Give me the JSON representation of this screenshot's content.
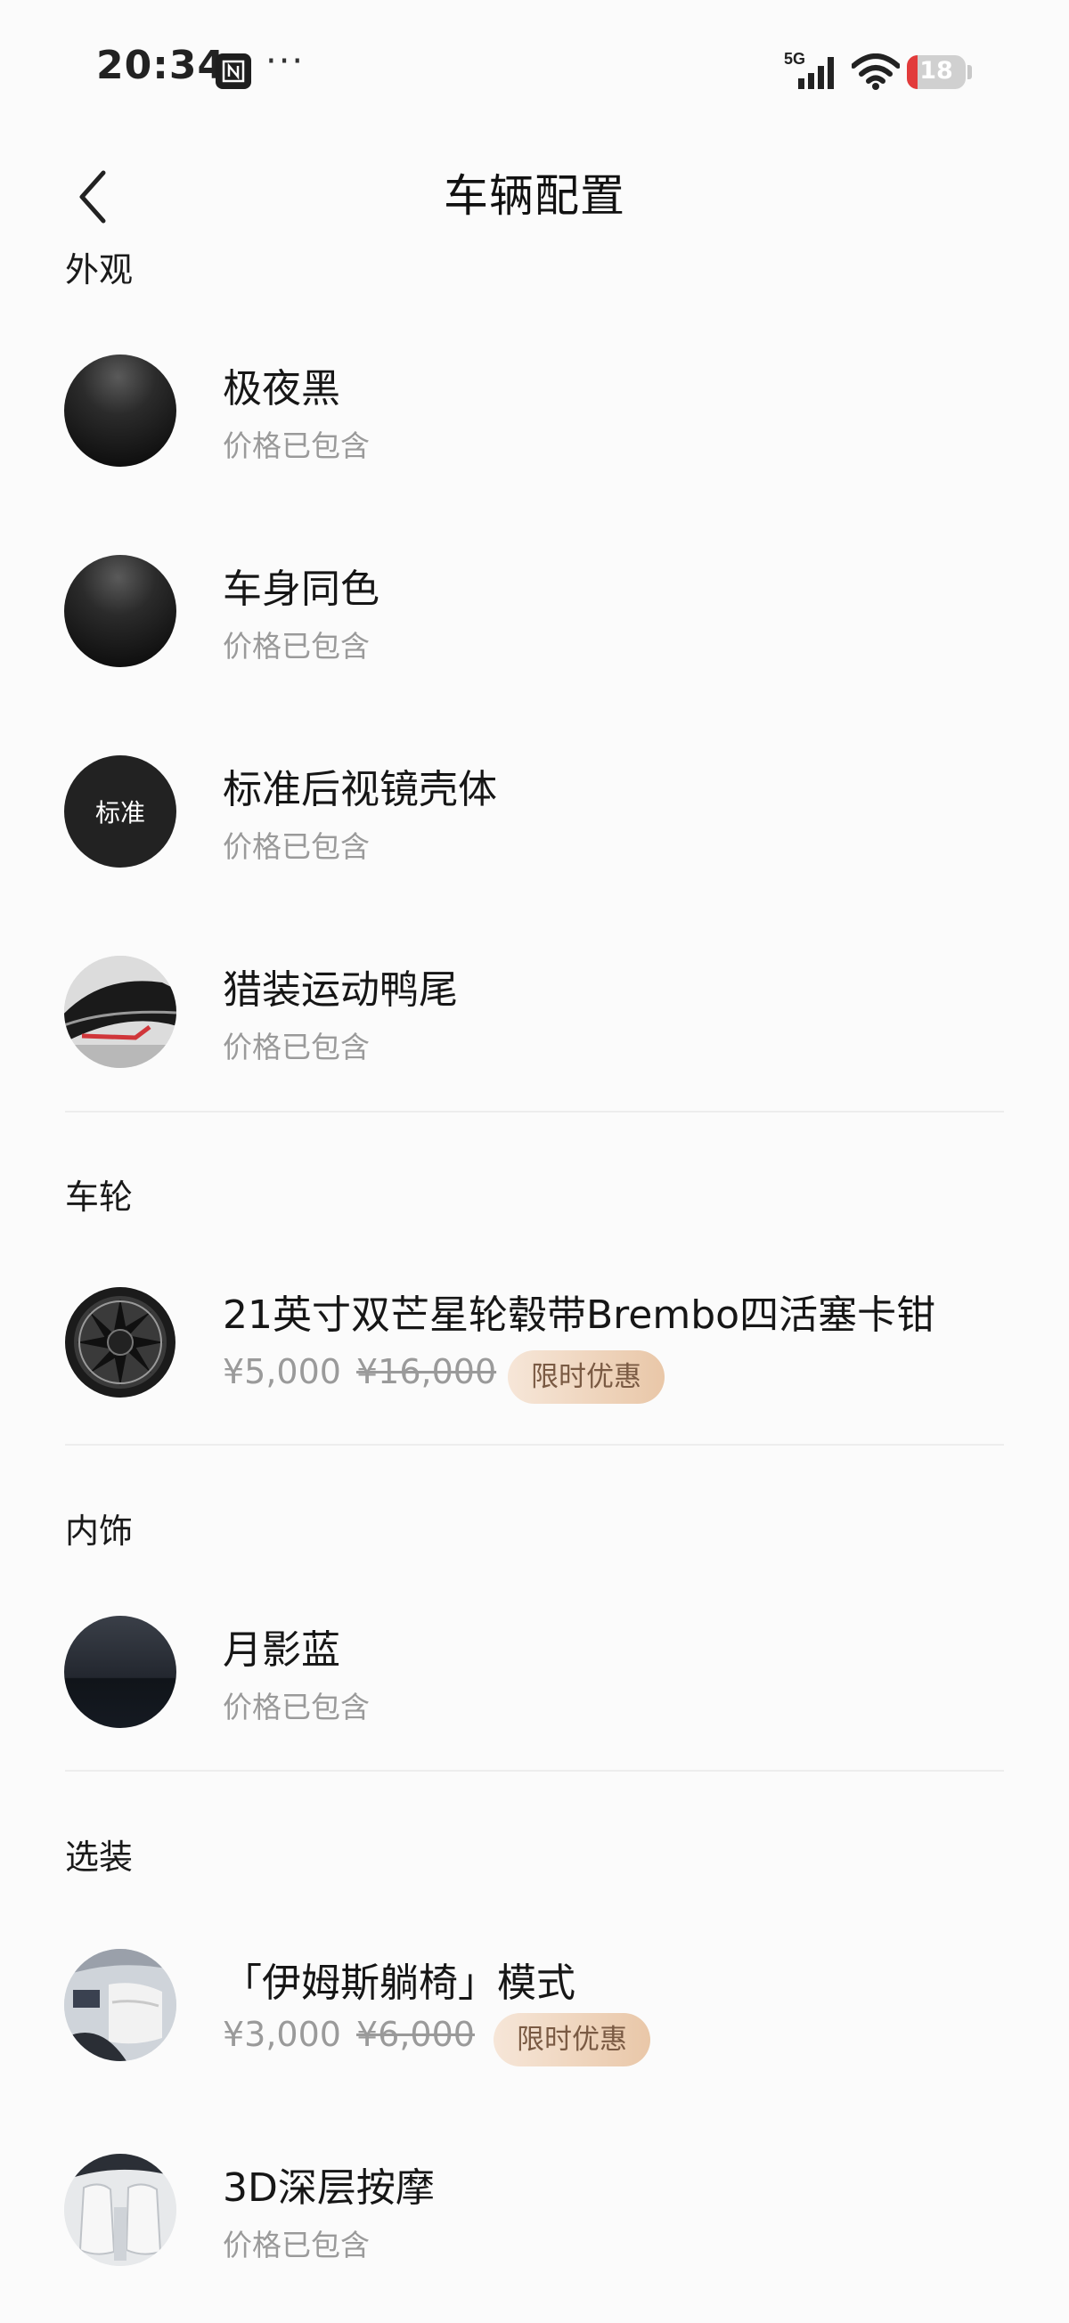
{
  "status_bar": {
    "time": "20:34",
    "dots": "···",
    "network": "5G",
    "battery_level": "18",
    "battery_fraction": 0.18,
    "battery_color": "#e23b3b"
  },
  "header": {
    "title": "车辆配置",
    "back_icon": "chevron-left-icon"
  },
  "sections": {
    "exterior": {
      "title": "外观",
      "items": [
        {
          "name": "极夜黑",
          "sub": "价格已包含"
        },
        {
          "name": "车身同色",
          "sub": "价格已包含"
        },
        {
          "name": "标准后视镜壳体",
          "sub": "价格已包含",
          "thumb_text": "标准"
        },
        {
          "name": "猎装运动鸭尾",
          "sub": "价格已包含"
        }
      ]
    },
    "wheels": {
      "title": "车轮",
      "items": [
        {
          "name": "21英寸双芒星轮毂带Brembo四活塞卡钳",
          "price": "¥5,000",
          "old_price": "¥16,000",
          "promo": "限时优惠"
        }
      ]
    },
    "interior": {
      "title": "内饰",
      "items": [
        {
          "name": "月影蓝",
          "sub": "价格已包含"
        }
      ]
    },
    "options": {
      "title": "选装",
      "items": [
        {
          "name": "「伊姆斯躺椅」模式",
          "price": "¥3,000",
          "old_price": "¥6,000",
          "promo": "限时优惠"
        },
        {
          "name": "3D深层按摩",
          "sub": "价格已包含"
        }
      ]
    }
  },
  "colors": {
    "promo_text": "#7a5a43",
    "promo_bg_start": "#f6e6d8",
    "promo_bg_end": "#e9c7a8",
    "muted_text": "#9a9a9a"
  }
}
